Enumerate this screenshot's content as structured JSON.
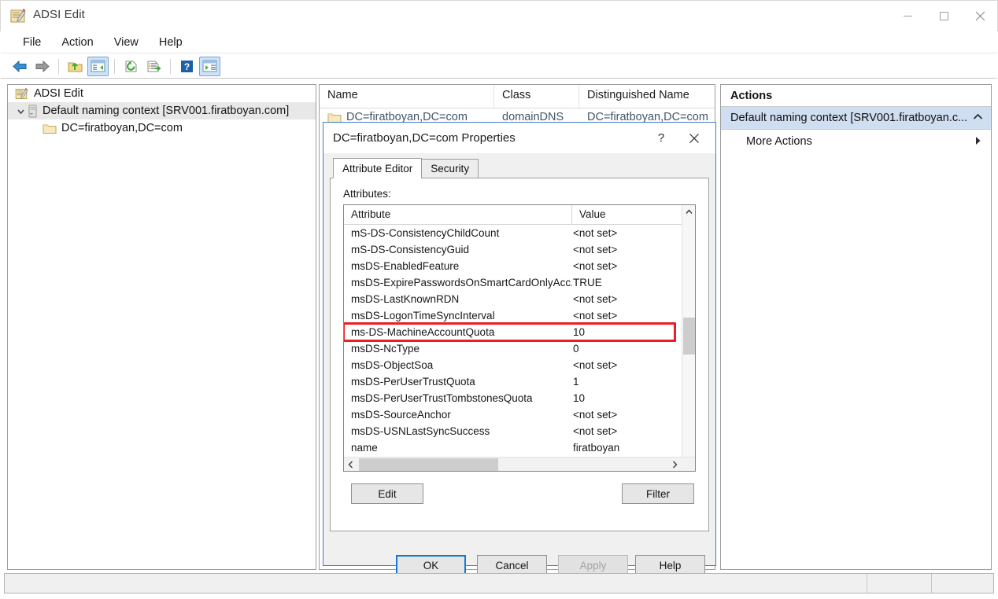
{
  "window": {
    "title": "ADSI Edit",
    "icon": "adsi-edit-icon",
    "controls": {
      "minimize": "–",
      "maximize": "□",
      "close": "✕"
    }
  },
  "menubar": {
    "items": [
      {
        "label": "File"
      },
      {
        "label": "Action"
      },
      {
        "label": "View"
      },
      {
        "label": "Help"
      }
    ]
  },
  "toolbar": {
    "buttons": [
      {
        "name": "back-arrow-icon",
        "tooltip": "Back"
      },
      {
        "name": "forward-arrow-icon",
        "tooltip": "Forward"
      },
      {
        "name": "up-folder-icon",
        "tooltip": "Up one level"
      },
      {
        "name": "show-hide-console-tree-icon",
        "tooltip": "Show/Hide Console Tree",
        "pressed": true
      },
      {
        "name": "refresh-icon",
        "tooltip": "Refresh"
      },
      {
        "name": "export-list-icon",
        "tooltip": "Export List"
      },
      {
        "name": "help-icon",
        "tooltip": "Help"
      },
      {
        "name": "show-hide-action-pane-icon",
        "tooltip": "Show/Hide Action Pane",
        "pressed": true
      }
    ]
  },
  "tree": {
    "root": {
      "label": "ADSI Edit",
      "icon": "adsi-edit-icon"
    },
    "nodes": [
      {
        "label": "Default naming context [SRV001.firatboyan.com]",
        "icon": "server-icon",
        "expanded": true,
        "selected": true,
        "chevron": "⌄"
      },
      {
        "label": "DC=firatboyan,DC=com",
        "icon": "folder-icon",
        "indent": true
      }
    ]
  },
  "listview": {
    "columns": [
      {
        "label": "Name"
      },
      {
        "label": "Class"
      },
      {
        "label": "Distinguished Name"
      }
    ],
    "rows": [
      {
        "name": "DC=firatboyan,DC=com",
        "class": "domainDNS",
        "dn": "DC=firatboyan,DC=com"
      }
    ]
  },
  "actions": {
    "header": "Actions",
    "group": {
      "label": "Default naming context [SRV001.firatboyan.c...",
      "collapse_glyph": "▲"
    },
    "items": [
      {
        "label": "More Actions",
        "submenu_glyph": "▶"
      }
    ]
  },
  "dialog": {
    "title": "DC=firatboyan,DC=com Properties",
    "help_button": "?",
    "close_button": "✕",
    "tabs": [
      {
        "label": "Attribute Editor",
        "active": true
      },
      {
        "label": "Security",
        "active": false
      }
    ],
    "attributes_label": "Attributes:",
    "table": {
      "headers": {
        "attribute": "Attribute",
        "value": "Value"
      },
      "rows": [
        {
          "attribute": "mS-DS-ConsistencyChildCount",
          "value": "<not set>",
          "highlight": false
        },
        {
          "attribute": "mS-DS-ConsistencyGuid",
          "value": "<not set>",
          "highlight": false
        },
        {
          "attribute": "msDS-EnabledFeature",
          "value": "<not set>",
          "highlight": false
        },
        {
          "attribute": "msDS-ExpirePasswordsOnSmartCardOnlyAcc...",
          "value": "TRUE",
          "highlight": false
        },
        {
          "attribute": "msDS-LastKnownRDN",
          "value": "<not set>",
          "highlight": false
        },
        {
          "attribute": "msDS-LogonTimeSyncInterval",
          "value": "<not set>",
          "highlight": false
        },
        {
          "attribute": "ms-DS-MachineAccountQuota",
          "value": "10",
          "highlight": true
        },
        {
          "attribute": "msDS-NcType",
          "value": "0",
          "highlight": false
        },
        {
          "attribute": "msDS-ObjectSoa",
          "value": "<not set>",
          "highlight": false
        },
        {
          "attribute": "msDS-PerUserTrustQuota",
          "value": "1",
          "highlight": false
        },
        {
          "attribute": "msDS-PerUserTrustTombstonesQuota",
          "value": "10",
          "highlight": false
        },
        {
          "attribute": "msDS-SourceAnchor",
          "value": "<not set>",
          "highlight": false
        },
        {
          "attribute": "msDS-USNLastSyncSuccess",
          "value": "<not set>",
          "highlight": false
        },
        {
          "attribute": "name",
          "value": "firatboyan",
          "highlight": false
        }
      ]
    },
    "scroll": {
      "up_glyph": "⌃",
      "down_glyph": "⌄",
      "left_glyph": "‹",
      "right_glyph": "›"
    },
    "buttons": {
      "edit": "Edit",
      "filter": "Filter",
      "ok": "OK",
      "cancel": "Cancel",
      "apply": "Apply",
      "help": "Help"
    }
  },
  "statusbar": {
    "text": ""
  },
  "colors": {
    "highlight_red": "#ee1c25",
    "default_button_blue": "#1778d4",
    "actions_group_blue": "#cfdef0",
    "toolbar_pressed": "#cce4f7"
  }
}
